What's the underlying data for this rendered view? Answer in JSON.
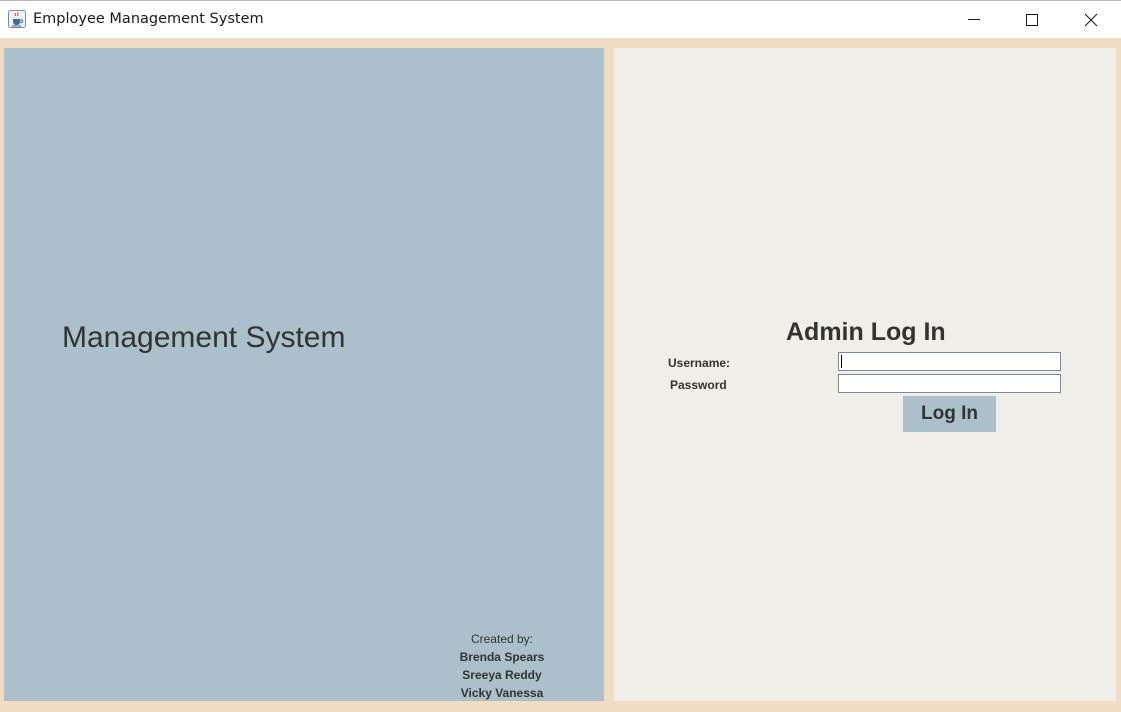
{
  "window": {
    "title": "Employee Management System",
    "icon": "java-cup-icon",
    "controls": {
      "minimize": "minimize-icon",
      "maximize": "maximize-icon",
      "close": "close-icon"
    }
  },
  "left_panel": {
    "heading": "Management System",
    "created_by_label": "Created by:",
    "authors": [
      "Brenda Spears",
      "Sreeya Reddy",
      "Vicky Vanessa"
    ]
  },
  "login": {
    "title": "Admin Log In",
    "username_label": "Username:",
    "username_value": "",
    "password_label": "Password",
    "password_value": "",
    "button_label": "Log In"
  },
  "colors": {
    "frame_background": "#f0dcc2",
    "left_panel_background": "#acc0cc",
    "right_panel_background": "#f0eee8",
    "button_background": "#acc0cc",
    "text": "#333333"
  }
}
